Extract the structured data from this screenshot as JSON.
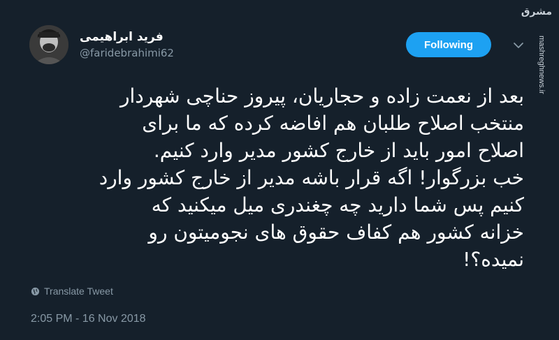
{
  "tweet": {
    "author": {
      "display_name": "فرید ابراهیمی",
      "handle": "@faridebrahimi62"
    },
    "follow_label": "Following",
    "text_lines": [
      "بعد از نعمت زاده و حجاریان، پیروز حناچی شهردار",
      "منتخب اصلاح طلبان هم افاضه کرده که ما برای",
      "اصلاح امور باید از خارج کشور مدیر وارد کنیم.",
      "خب بزرگوار! اگه قرار باشه مدیر از خارج کشور وارد",
      "کنیم پس شما دارید چه چغندری میل میکنید که",
      "خزانه کشور هم کفاف حقوق های نجومیتون رو",
      "نمیده؟!"
    ],
    "translate_label": "Translate Tweet",
    "timestamp": "2:05 PM - 16 Nov 2018"
  },
  "watermark": {
    "logo_text": "مشرق",
    "site": "mashreghnews.ir"
  },
  "colors": {
    "background": "#15202b",
    "accent": "#1da1f2",
    "secondary_text": "#8899a6",
    "primary_text": "#ffffff"
  },
  "icons": {
    "more": "chevron-down-icon",
    "translate": "globe-icon"
  }
}
